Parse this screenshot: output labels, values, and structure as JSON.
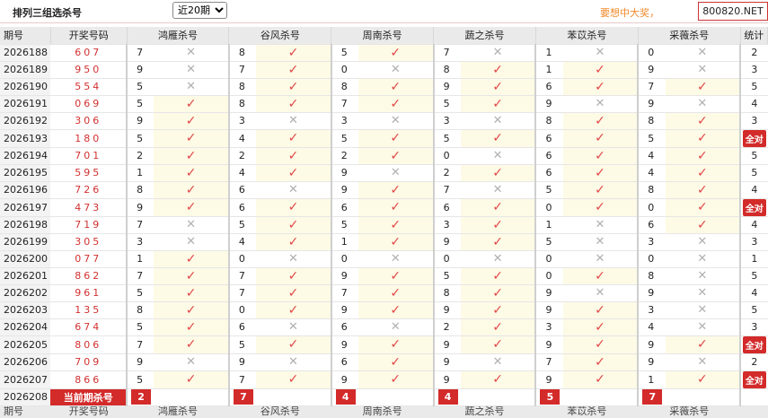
{
  "header": {
    "title": "排列三组选杀号",
    "range_select": "近20期",
    "ad_text": "要想中大奖，",
    "site_badge": "800820.NET"
  },
  "columns": {
    "issue": "期号",
    "draw": "开奖号码",
    "experts": [
      "鸿雁杀号",
      "谷风杀号",
      "周南杀号",
      "蔬之杀号",
      "苯苡杀号",
      "采薇杀号"
    ],
    "stat": "统计"
  },
  "all_hit_label": "全对",
  "rows": [
    {
      "issue": "2026188",
      "draw": "607",
      "kills": [
        7,
        8,
        5,
        7,
        1,
        0
      ],
      "hits": [
        false,
        true,
        true,
        false,
        false,
        false
      ],
      "stat": "2"
    },
    {
      "issue": "2026189",
      "draw": "950",
      "kills": [
        9,
        7,
        0,
        8,
        1,
        9
      ],
      "hits": [
        false,
        true,
        false,
        true,
        true,
        false
      ],
      "stat": "3"
    },
    {
      "issue": "2026190",
      "draw": "554",
      "kills": [
        5,
        8,
        8,
        9,
        6,
        7
      ],
      "hits": [
        false,
        true,
        true,
        true,
        true,
        true
      ],
      "stat": "5"
    },
    {
      "issue": "2026191",
      "draw": "069",
      "kills": [
        5,
        8,
        7,
        5,
        9,
        9
      ],
      "hits": [
        true,
        true,
        true,
        true,
        false,
        false
      ],
      "stat": "4"
    },
    {
      "issue": "2026192",
      "draw": "306",
      "kills": [
        9,
        3,
        3,
        3,
        8,
        8
      ],
      "hits": [
        true,
        false,
        false,
        false,
        true,
        true
      ],
      "stat": "3"
    },
    {
      "issue": "2026193",
      "draw": "180",
      "kills": [
        5,
        4,
        5,
        5,
        6,
        5
      ],
      "hits": [
        true,
        true,
        true,
        true,
        true,
        true
      ],
      "stat": "全对"
    },
    {
      "issue": "2026194",
      "draw": "701",
      "kills": [
        2,
        2,
        2,
        0,
        6,
        4
      ],
      "hits": [
        true,
        true,
        true,
        false,
        true,
        true
      ],
      "stat": "5"
    },
    {
      "issue": "2026195",
      "draw": "595",
      "kills": [
        1,
        4,
        9,
        2,
        6,
        4
      ],
      "hits": [
        true,
        true,
        false,
        true,
        true,
        true
      ],
      "stat": "5"
    },
    {
      "issue": "2026196",
      "draw": "726",
      "kills": [
        8,
        6,
        9,
        7,
        5,
        8
      ],
      "hits": [
        true,
        false,
        true,
        false,
        true,
        true
      ],
      "stat": "4"
    },
    {
      "issue": "2026197",
      "draw": "473",
      "kills": [
        9,
        6,
        6,
        6,
        0,
        0
      ],
      "hits": [
        true,
        true,
        true,
        true,
        true,
        true
      ],
      "stat": "全对"
    },
    {
      "issue": "2026198",
      "draw": "719",
      "kills": [
        7,
        5,
        5,
        3,
        1,
        6
      ],
      "hits": [
        false,
        true,
        true,
        true,
        false,
        true
      ],
      "stat": "4"
    },
    {
      "issue": "2026199",
      "draw": "305",
      "kills": [
        3,
        4,
        1,
        9,
        5,
        3
      ],
      "hits": [
        false,
        true,
        true,
        true,
        false,
        false
      ],
      "stat": "3"
    },
    {
      "issue": "2026200",
      "draw": "077",
      "kills": [
        1,
        0,
        0,
        0,
        0,
        0
      ],
      "hits": [
        true,
        false,
        false,
        false,
        false,
        false
      ],
      "stat": "1"
    },
    {
      "issue": "2026201",
      "draw": "862",
      "kills": [
        7,
        7,
        9,
        5,
        0,
        8
      ],
      "hits": [
        true,
        true,
        true,
        true,
        true,
        false
      ],
      "stat": "5"
    },
    {
      "issue": "2026202",
      "draw": "961",
      "kills": [
        5,
        7,
        7,
        8,
        9,
        9
      ],
      "hits": [
        true,
        true,
        true,
        true,
        false,
        false
      ],
      "stat": "4"
    },
    {
      "issue": "2026203",
      "draw": "135",
      "kills": [
        8,
        0,
        9,
        9,
        9,
        3
      ],
      "hits": [
        true,
        true,
        true,
        true,
        true,
        false
      ],
      "stat": "5"
    },
    {
      "issue": "2026204",
      "draw": "674",
      "kills": [
        5,
        6,
        6,
        2,
        3,
        4
      ],
      "hits": [
        true,
        false,
        false,
        true,
        true,
        false
      ],
      "stat": "3"
    },
    {
      "issue": "2026205",
      "draw": "806",
      "kills": [
        7,
        5,
        9,
        9,
        9,
        9
      ],
      "hits": [
        true,
        true,
        true,
        true,
        true,
        true
      ],
      "stat": "全对"
    },
    {
      "issue": "2026206",
      "draw": "709",
      "kills": [
        9,
        9,
        6,
        9,
        7,
        9
      ],
      "hits": [
        false,
        false,
        true,
        false,
        true,
        false
      ],
      "stat": "2"
    },
    {
      "issue": "2026207",
      "draw": "866",
      "kills": [
        5,
        7,
        9,
        9,
        9,
        1
      ],
      "hits": [
        true,
        true,
        true,
        true,
        true,
        true
      ],
      "stat": "全对"
    }
  ],
  "current": {
    "issue": "2026208",
    "label": "当前期杀号",
    "kills": [
      2,
      7,
      4,
      4,
      5,
      7
    ]
  },
  "footer": {
    "issue": "期号",
    "draw": "开奖号码",
    "experts": [
      "鸿雁杀号",
      "谷风杀号",
      "周南杀号",
      "蔬之杀号",
      "苯苡杀号",
      "采薇杀号"
    ]
  },
  "icons": {
    "hit": "check-icon",
    "miss": "cross-icon"
  },
  "colors": {
    "accent": "#d32a2a",
    "check": "#e24646",
    "hit_bg": "#fdfae6",
    "ad": "#f08a2a"
  }
}
